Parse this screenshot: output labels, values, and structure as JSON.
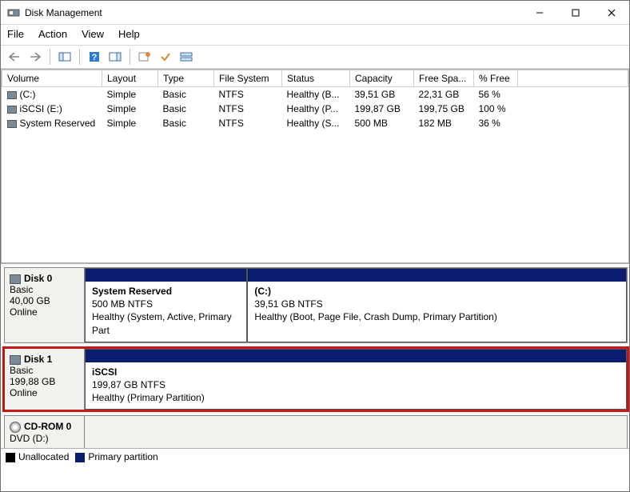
{
  "window": {
    "title": "Disk Management"
  },
  "menu": {
    "file": "File",
    "action": "Action",
    "view": "View",
    "help": "Help"
  },
  "columns": {
    "volume": "Volume",
    "layout": "Layout",
    "type": "Type",
    "fs": "File System",
    "status": "Status",
    "capacity": "Capacity",
    "free": "Free Spa...",
    "pct": "% Free"
  },
  "volumes": [
    {
      "name": "(C:)",
      "layout": "Simple",
      "type": "Basic",
      "fs": "NTFS",
      "status": "Healthy (B...",
      "capacity": "39,51 GB",
      "free": "22,31 GB",
      "pct": "56 %"
    },
    {
      "name": "iSCSI (E:)",
      "layout": "Simple",
      "type": "Basic",
      "fs": "NTFS",
      "status": "Healthy (P...",
      "capacity": "199,87 GB",
      "free": "199,75 GB",
      "pct": "100 %"
    },
    {
      "name": "System Reserved",
      "layout": "Simple",
      "type": "Basic",
      "fs": "NTFS",
      "status": "Healthy (S...",
      "capacity": "500 MB",
      "free": "182 MB",
      "pct": "36 %"
    }
  ],
  "disks": [
    {
      "label": "Disk 0",
      "type": "Basic",
      "size": "40,00 GB",
      "state": "Online",
      "highlight": false,
      "kind": "disk",
      "partitions": [
        {
          "name": "System Reserved",
          "size": "500 MB NTFS",
          "status": "Healthy (System, Active, Primary Part",
          "width": "30%"
        },
        {
          "name": "(C:)",
          "size": "39,51 GB NTFS",
          "status": "Healthy (Boot, Page File, Crash Dump, Primary Partition)",
          "width": "70%"
        }
      ]
    },
    {
      "label": "Disk 1",
      "type": "Basic",
      "size": "199,88 GB",
      "state": "Online",
      "highlight": true,
      "kind": "disk",
      "partitions": [
        {
          "name": "iSCSI",
          "size": "199,87 GB NTFS",
          "status": "Healthy (Primary Partition)",
          "width": "100%"
        }
      ]
    },
    {
      "label": "CD-ROM 0",
      "type": "DVD (D:)",
      "size": "",
      "state": "",
      "highlight": false,
      "kind": "cdrom",
      "partitions": []
    }
  ],
  "legend": {
    "unalloc": "Unallocated",
    "primary": "Primary partition"
  }
}
